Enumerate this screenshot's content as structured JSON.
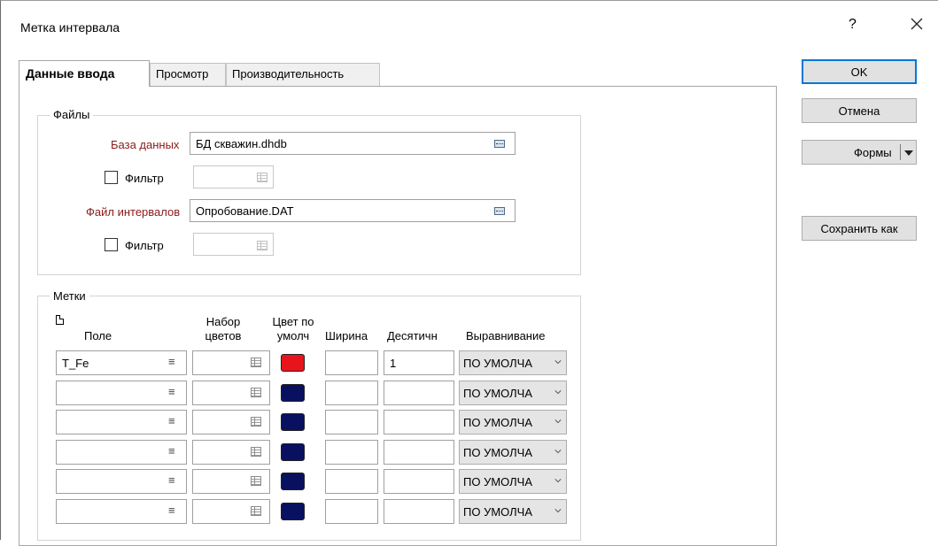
{
  "window": {
    "title": "Метка интервала",
    "help_label": "?",
    "close_icon": "close-icon"
  },
  "tabs": [
    {
      "label": "Данные ввода",
      "active": true
    },
    {
      "label": "Просмотр",
      "active": false
    },
    {
      "label": "Производительность",
      "active": false
    }
  ],
  "files_group": {
    "legend": "Файлы",
    "database_label": "База данных",
    "database_value": "БД скважин.dhdb",
    "filter1_label": "Фильтр",
    "filter1_checked": false,
    "interval_label": "Файл интервалов",
    "interval_value": "Опробование.DAT",
    "filter2_label": "Фильтр",
    "filter2_checked": false
  },
  "labels_group": {
    "legend": "Метки",
    "columns": {
      "field": "Поле",
      "colorset_line1": "Набор",
      "colorset_line2": "цветов",
      "default_color_line1": "Цвет по",
      "default_color_line2": "умолч",
      "width": "Ширина",
      "decimals": "Десятичн",
      "alignment": "Выравнивание"
    },
    "rows": [
      {
        "field": "T_Fe",
        "color": "#e8141c",
        "width": "",
        "decimals": "1",
        "alignment": "ПО УМОЛЧА"
      },
      {
        "field": "",
        "color": "#0a1060",
        "width": "",
        "decimals": "",
        "alignment": "ПО УМОЛЧА"
      },
      {
        "field": "",
        "color": "#0a1060",
        "width": "",
        "decimals": "",
        "alignment": "ПО УМОЛЧА"
      },
      {
        "field": "",
        "color": "#0a1060",
        "width": "",
        "decimals": "",
        "alignment": "ПО УМОЛЧА"
      },
      {
        "field": "",
        "color": "#0a1060",
        "width": "",
        "decimals": "",
        "alignment": "ПО УМОЛЧА"
      },
      {
        "field": "",
        "color": "#0a1060",
        "width": "",
        "decimals": "",
        "alignment": "ПО УМОЛЧА"
      }
    ]
  },
  "buttons": {
    "ok": "OK",
    "cancel": "Отмена",
    "forms": "Формы",
    "save_as": "Сохранить как"
  },
  "colors": {
    "accent": "#0078d7",
    "required_label": "#8b1a1a"
  }
}
